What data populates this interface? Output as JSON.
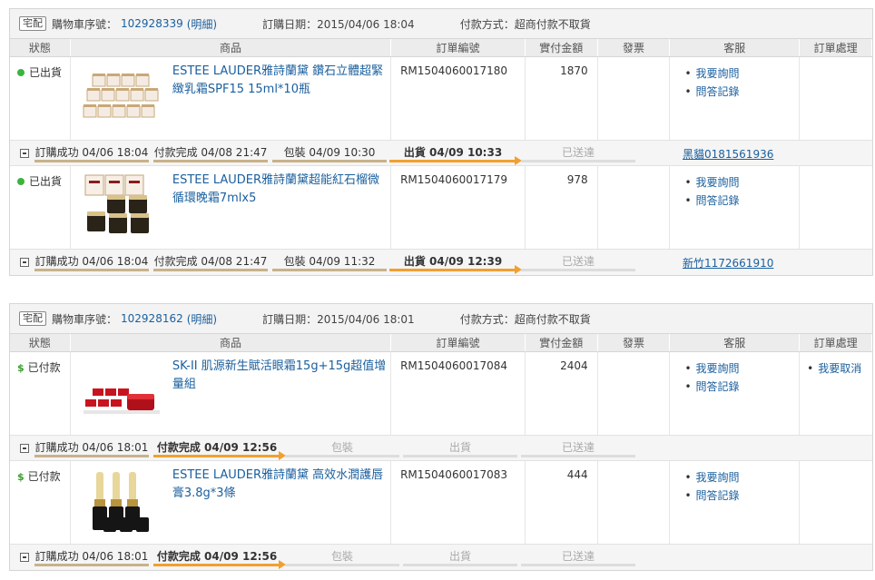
{
  "labels": {
    "tag": "宅配",
    "cart_no": "購物車序號：",
    "detail": "(明細)",
    "order_date": "訂購日期：",
    "payment_method": "付款方式：",
    "col_status": "狀態",
    "col_product": "商品",
    "col_order_no": "訂單編號",
    "col_paid": "實付金額",
    "col_invoice": "發票",
    "col_service": "客服",
    "col_process": "訂單處理",
    "svc_ask": "我要詢問",
    "svc_history": "問答記錄",
    "cancel": "我要取消"
  },
  "orders": [
    {
      "cart_no": "102928339",
      "order_date": "2015/04/06 18:04",
      "payment": "超商付款不取貨",
      "items": [
        {
          "status": "已出貨",
          "product": "ESTEE LAUDER雅詩蘭黛 鑽石立體超緊緻乳霜SPF15 15ml*10瓶",
          "order_no": "RM1504060017180",
          "paid": "1870",
          "steps": [
            "訂購成功 04/06 18:04",
            "付款完成 04/08 21:47",
            "包裝 04/09 10:30",
            "出貨 04/09 10:33",
            "已送達"
          ],
          "tracking": "黑貓0181561936"
        },
        {
          "status": "已出貨",
          "product": "ESTEE LAUDER雅詩蘭黛超能紅石榴微循環晚霜7mlx5",
          "order_no": "RM1504060017179",
          "paid": "978",
          "steps": [
            "訂購成功 04/06 18:04",
            "付款完成 04/08 21:47",
            "包裝 04/09 11:32",
            "出貨 04/09 12:39",
            "已送達"
          ],
          "tracking": "新竹1172661910"
        }
      ]
    },
    {
      "cart_no": "102928162",
      "order_date": "2015/04/06 18:01",
      "payment": "超商付款不取貨",
      "items": [
        {
          "status": "已付款",
          "product": "SK-II 肌源新生賦活眼霜15g+15g超值增量組",
          "order_no": "RM1504060017084",
          "paid": "2404",
          "steps": [
            "訂購成功 04/06 18:01",
            "付款完成 04/09 12:56",
            "包裝",
            "出貨",
            "已送達"
          ]
        },
        {
          "status": "已付款",
          "product": "ESTEE LAUDER雅詩蘭黛 高效水潤護唇膏3.8g*3條",
          "order_no": "RM1504060017083",
          "paid": "444",
          "steps": [
            "訂購成功 04/06 18:01",
            "付款完成 04/09 12:56",
            "包裝",
            "出貨",
            "已送達"
          ]
        }
      ]
    }
  ],
  "colors": {
    "link": "#1a5f9e",
    "progress": "#f0a030",
    "shipped_dot": "#3cb43c",
    "paid_sign": "#3a9d2e"
  },
  "icons": {
    "shipped": "green-dot-icon",
    "paid": "dollar-sign-icon",
    "collapse": "collapse-minus-icon"
  }
}
